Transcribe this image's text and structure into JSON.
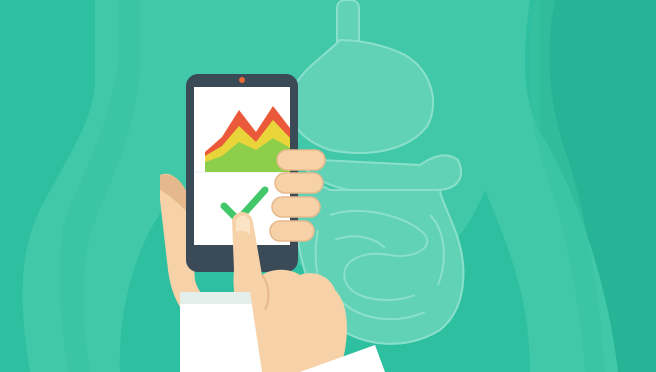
{
  "colors": {
    "background": "#2dbf9f",
    "background_dark": "#21a98b",
    "silhouette": "#5fd3b7",
    "organs": "#7fdcc6",
    "phone_body": "#3b4a57",
    "phone_screen": "#ffffff",
    "phone_camera": "#e86a38",
    "chart_red": "#ea5a3a",
    "chart_orange": "#f39a37",
    "chart_yellow": "#e9d53a",
    "chart_green": "#8dcf4a",
    "check": "#43c76b",
    "skin": "#f7d2a8",
    "skin_shadow": "#e6b98d",
    "sleeve": "#ffffff",
    "sleeve_shadow": "#d8e6e2"
  },
  "icons": {
    "chart": "mountain-chart-icon",
    "check": "check-mark-icon"
  },
  "chart_data": {
    "type": "area",
    "series": [
      {
        "values": [
          0.2,
          0.35,
          0.62,
          0.4,
          0.66,
          0.44
        ]
      },
      {
        "values": [
          0.16,
          0.26,
          0.46,
          0.3,
          0.52,
          0.34
        ]
      },
      {
        "values": [
          0.1,
          0.16,
          0.3,
          0.22,
          0.34,
          0.24
        ]
      }
    ]
  }
}
